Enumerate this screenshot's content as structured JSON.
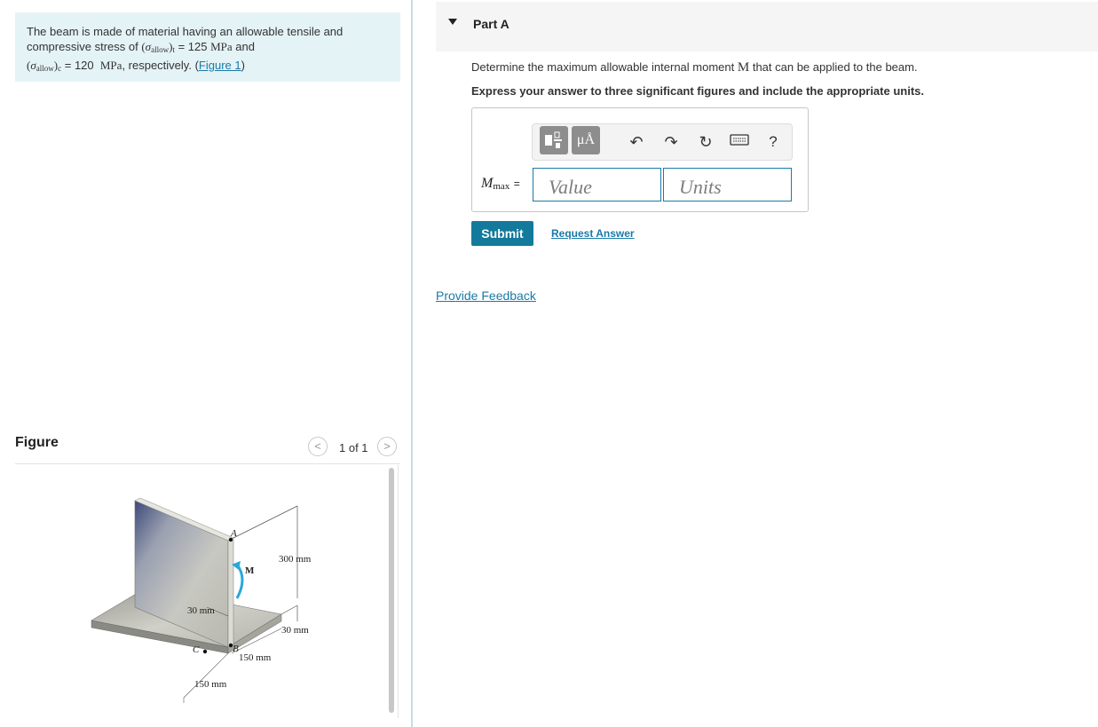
{
  "problem": {
    "text_1": "The beam is made of material having an allowable tensile and compressive stress of",
    "sigma_symbol": "σ",
    "allow_sub": "allow",
    "t_sub": "t",
    "c_sub": "c",
    "t_value": "= 125",
    "t_unit": "MPa",
    "and": "and",
    "c_value": "= 120",
    "c_unit": "MPa",
    "tail": ", respectively.",
    "figure_link": "Figure 1"
  },
  "figure": {
    "title": "Figure",
    "pager": "1 of 1",
    "prev": "<",
    "next": ">",
    "labels": {
      "a": "A",
      "b": "B",
      "c": "C",
      "m": "M",
      "d300": "300 mm",
      "d30_left": "30 mm",
      "d30_right": "30 mm",
      "d150_right": "150 mm",
      "d150_bottom": "150 mm"
    }
  },
  "part": {
    "title": "Part A",
    "question_prefix": "Determine the maximum allowable internal moment",
    "question_symbol": "M",
    "question_suffix": "that can be applied to the beam.",
    "instruction": "Express your answer to three significant figures and include the appropriate units.",
    "answer_label_main": "M",
    "answer_label_sub": "max",
    "answer_label_eq": "=",
    "value_placeholder": "Value",
    "units_placeholder": "Units",
    "toolbar": {
      "units_button": "μÅ",
      "help": "?"
    },
    "submit": "Submit",
    "request_answer": "Request Answer"
  },
  "feedback": "Provide Feedback"
}
